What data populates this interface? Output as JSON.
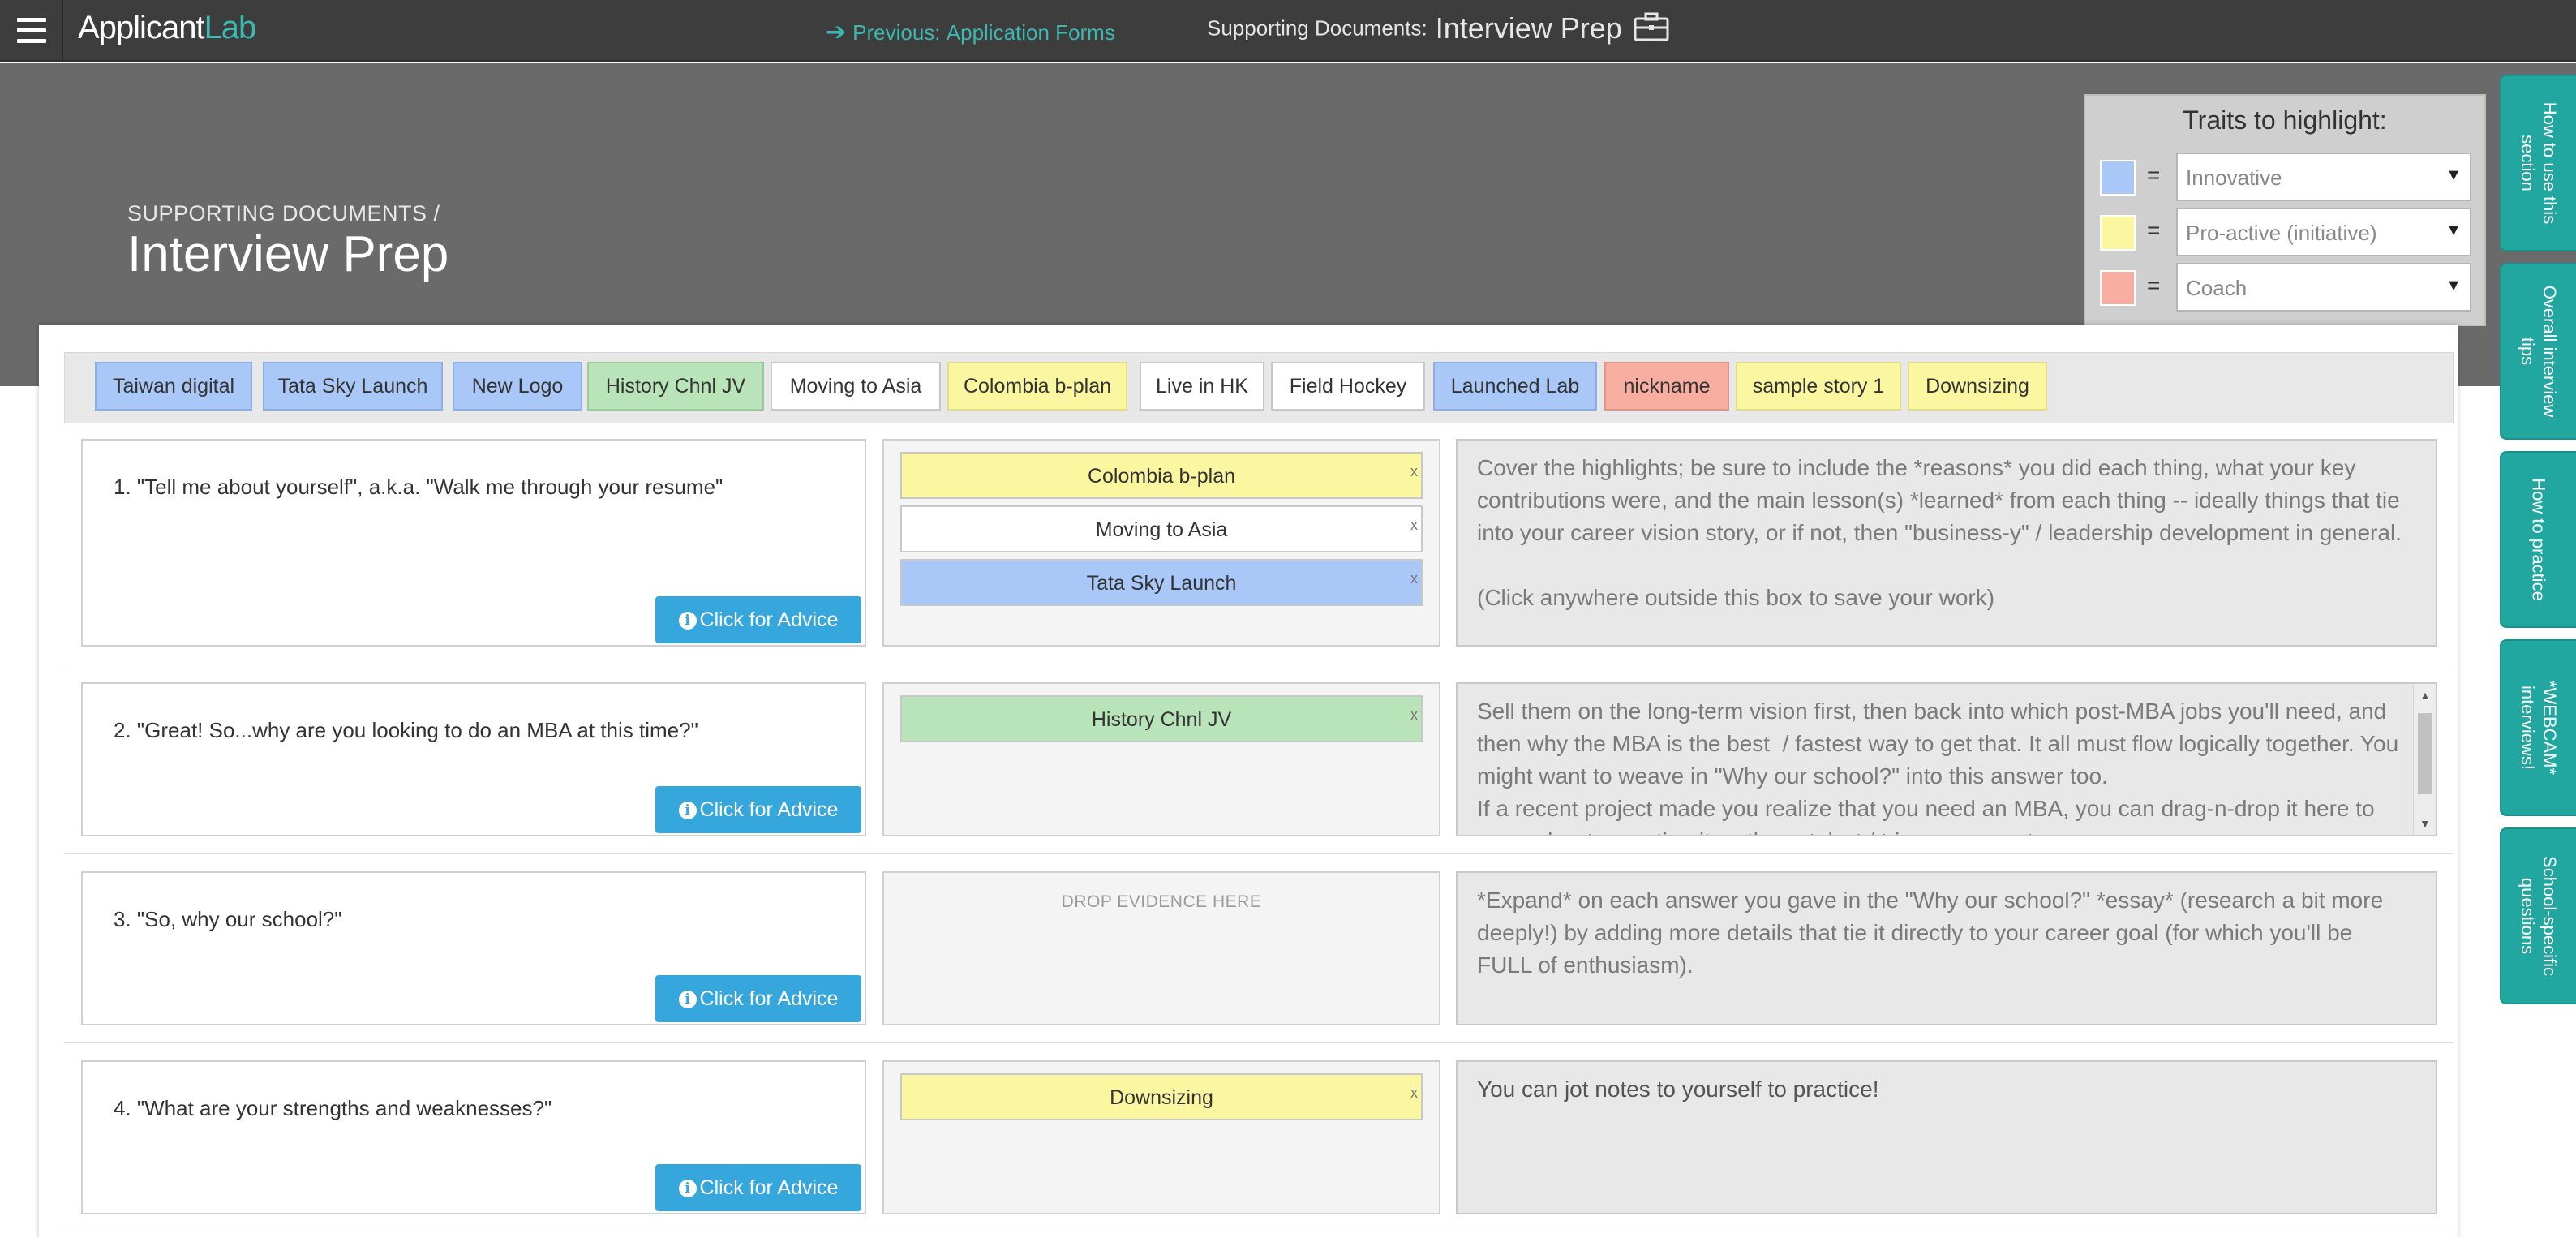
{
  "app": {
    "logo_main": "Applicant",
    "logo_accent": "Lab"
  },
  "topbar": {
    "prev_prefix": "Previous:",
    "prev_link": "Application Forms",
    "section_label": "Supporting Documents:",
    "section_title": "Interview Prep"
  },
  "header": {
    "subtitle": "SUPPORTING DOCUMENTS /",
    "title": "Interview Prep"
  },
  "traits": {
    "title": "Traits to highlight:",
    "eq": "=",
    "rows": [
      {
        "color": "#a9c8f7",
        "value": "Innovative"
      },
      {
        "color": "#fbf7a1",
        "value": "Pro-active (initiative)"
      },
      {
        "color": "#f7ad9f",
        "value": "Coach"
      }
    ]
  },
  "side_tabs": [
    "How to use this\nsection",
    "Overall interview\ntips",
    "How to practice",
    "*WEBCAM*\ninterviews!",
    "School-specific\nquestions"
  ],
  "chips": [
    {
      "label": "Taiwan digital",
      "color": "blue"
    },
    {
      "label": "Tata Sky Launch",
      "color": "blue"
    },
    {
      "label": "New Logo",
      "color": "blue"
    },
    {
      "label": "History Chnl JV",
      "color": "green"
    },
    {
      "label": "Moving to Asia",
      "color": "white"
    },
    {
      "label": "Colombia b-plan",
      "color": "yellow"
    },
    {
      "label": "Live in HK",
      "color": "white"
    },
    {
      "label": "Field Hockey",
      "color": "white"
    },
    {
      "label": "Launched Lab",
      "color": "blue"
    },
    {
      "label": "nickname",
      "color": "red"
    },
    {
      "label": "sample story 1",
      "color": "yellow"
    },
    {
      "label": "Downsizing",
      "color": "yellow"
    }
  ],
  "advice_label": "Click for Advice",
  "drop_hint": "DROP EVIDENCE HERE",
  "remove_symbol": "x",
  "questions": [
    {
      "text": "1. \"Tell me about yourself\", a.k.a. \"Walk me through your resume\"",
      "evidence": [
        {
          "label": "Colombia b-plan",
          "color": "yellow"
        },
        {
          "label": "Moving to Asia",
          "color": "white"
        },
        {
          "label": "Tata Sky Launch",
          "color": "blue"
        }
      ],
      "notes": "Cover the highlights; be sure to include the *reasons* you did each thing, what your key contributions were, and the main lesson(s) *learned* from each thing -- ideally things that tie into your career vision story, or if not, then \"business-y\" / leadership development in general.\n\n(Click anywhere outside this box to save your work)"
    },
    {
      "text": "2. \"Great! So...why are you looking to do an MBA at this time?\"",
      "evidence": [
        {
          "label": "History Chnl JV",
          "color": "green"
        }
      ],
      "notes": "Sell them on the long-term vision first, then back into which post-MBA jobs you'll need, and then why the MBA is the best  / fastest way to get that. It all must flow logically together. You might want to weave in \"Why our school?\" into this answer too.\nIf a recent project made you realize that you need an MBA, you can drag-n-drop it here to remember to mention it as the catalyst / trigger moment."
    },
    {
      "text": "3. \"So, why our school?\"",
      "evidence": [],
      "notes": "*Expand* on each answer you gave in the \"Why our school?\" *essay* (research a bit more deeply!) by adding more details that tie it directly to your career goal (for which you'll be FULL of enthusiasm)."
    },
    {
      "text": "4. \"What are your strengths and weaknesses?\"",
      "evidence": [
        {
          "label": "Downsizing",
          "color": "yellow"
        }
      ],
      "notes": "You can jot notes to yourself to practice!"
    }
  ]
}
